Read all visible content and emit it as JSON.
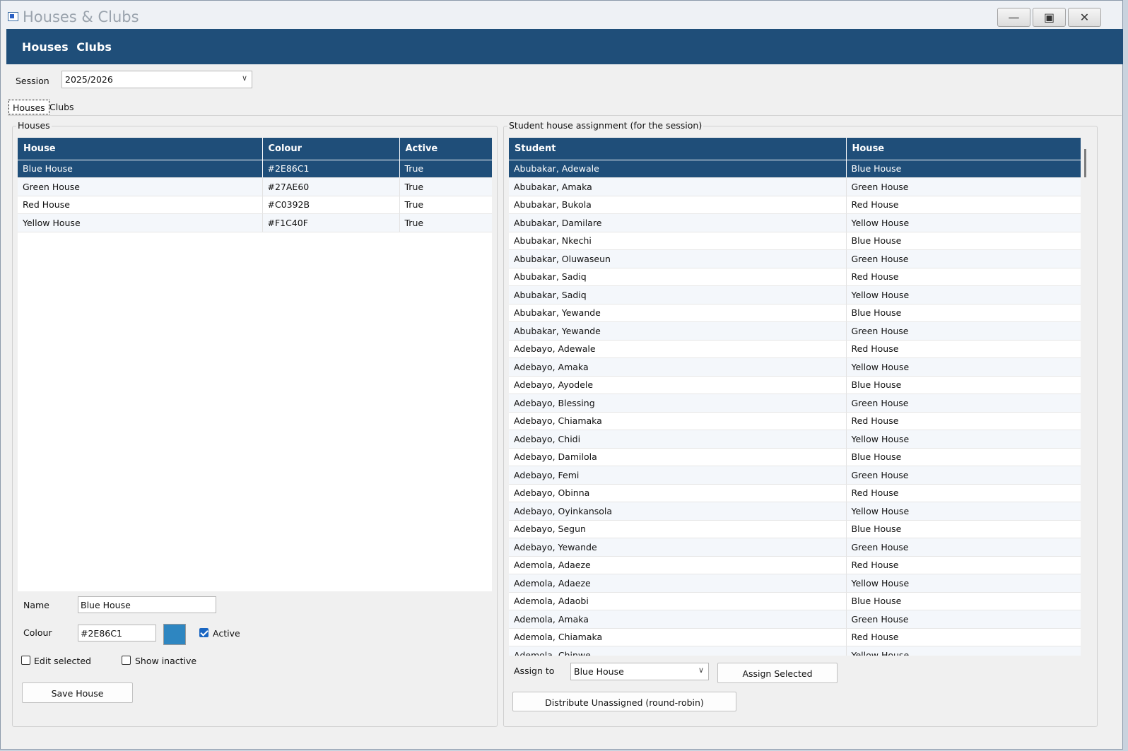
{
  "window": {
    "title": "Houses & Clubs"
  },
  "header": {
    "houses_label": "Houses",
    "clubs_label": "Clubs"
  },
  "session": {
    "label": "Session",
    "value": "2025/2026"
  },
  "tabs": [
    {
      "label": "Houses"
    },
    {
      "label": "Clubs"
    }
  ],
  "houses_group": {
    "legend": "Houses",
    "columns": [
      "House",
      "Colour",
      "Active"
    ],
    "rows": [
      {
        "house": "Blue House",
        "colour": "#2E86C1",
        "active": "True"
      },
      {
        "house": "Green House",
        "colour": "#27AE60",
        "active": "True"
      },
      {
        "house": "Red House",
        "colour": "#C0392B",
        "active": "True"
      },
      {
        "house": "Yellow House",
        "colour": "#F1C40F",
        "active": "True"
      }
    ],
    "selected_row": 0
  },
  "editor": {
    "name_label": "Name",
    "name_value": "Blue House",
    "colour_label": "Colour",
    "colour_value": "#2E86C1",
    "swatch_color": "#2E86C1",
    "active_label": "Active",
    "active_checked": true,
    "edit_selected_label": "Edit selected",
    "edit_selected_checked": false,
    "show_inactive_label": "Show inactive",
    "show_inactive_checked": false,
    "save_button": "Save House"
  },
  "assignment_group": {
    "legend": "Student house assignment (for the session)",
    "columns": [
      "Student",
      "House"
    ],
    "rows": [
      {
        "student": "Abubakar, Adewale",
        "house": "Blue House"
      },
      {
        "student": "Abubakar, Amaka",
        "house": "Green House"
      },
      {
        "student": "Abubakar, Bukola",
        "house": "Red House"
      },
      {
        "student": "Abubakar, Damilare",
        "house": "Yellow House"
      },
      {
        "student": "Abubakar, Nkechi",
        "house": "Blue House"
      },
      {
        "student": "Abubakar, Oluwaseun",
        "house": "Green House"
      },
      {
        "student": "Abubakar, Sadiq",
        "house": "Red House"
      },
      {
        "student": "Abubakar, Sadiq",
        "house": "Yellow House"
      },
      {
        "student": "Abubakar, Yewande",
        "house": "Blue House"
      },
      {
        "student": "Abubakar, Yewande",
        "house": "Green House"
      },
      {
        "student": "Adebayo, Adewale",
        "house": "Red House"
      },
      {
        "student": "Adebayo, Amaka",
        "house": "Yellow House"
      },
      {
        "student": "Adebayo, Ayodele",
        "house": "Blue House"
      },
      {
        "student": "Adebayo, Blessing",
        "house": "Green House"
      },
      {
        "student": "Adebayo, Chiamaka",
        "house": "Red House"
      },
      {
        "student": "Adebayo, Chidi",
        "house": "Yellow House"
      },
      {
        "student": "Adebayo, Damilola",
        "house": "Blue House"
      },
      {
        "student": "Adebayo, Femi",
        "house": "Green House"
      },
      {
        "student": "Adebayo, Obinna",
        "house": "Red House"
      },
      {
        "student": "Adebayo, Oyinkansola",
        "house": "Yellow House"
      },
      {
        "student": "Adebayo, Segun",
        "house": "Blue House"
      },
      {
        "student": "Adebayo, Yewande",
        "house": "Green House"
      },
      {
        "student": "Ademola, Adaeze",
        "house": "Red House"
      },
      {
        "student": "Ademola, Adaeze",
        "house": "Yellow House"
      },
      {
        "student": "Ademola, Adaobi",
        "house": "Blue House"
      },
      {
        "student": "Ademola, Amaka",
        "house": "Green House"
      },
      {
        "student": "Ademola, Chiamaka",
        "house": "Red House"
      },
      {
        "student": "Ademola, Chinwe",
        "house": "Yellow House"
      }
    ],
    "selected_row": 0
  },
  "assign": {
    "label": "Assign to",
    "value": "Blue House",
    "assign_button": "Assign Selected",
    "distribute_button": "Distribute Unassigned (round-robin)"
  }
}
